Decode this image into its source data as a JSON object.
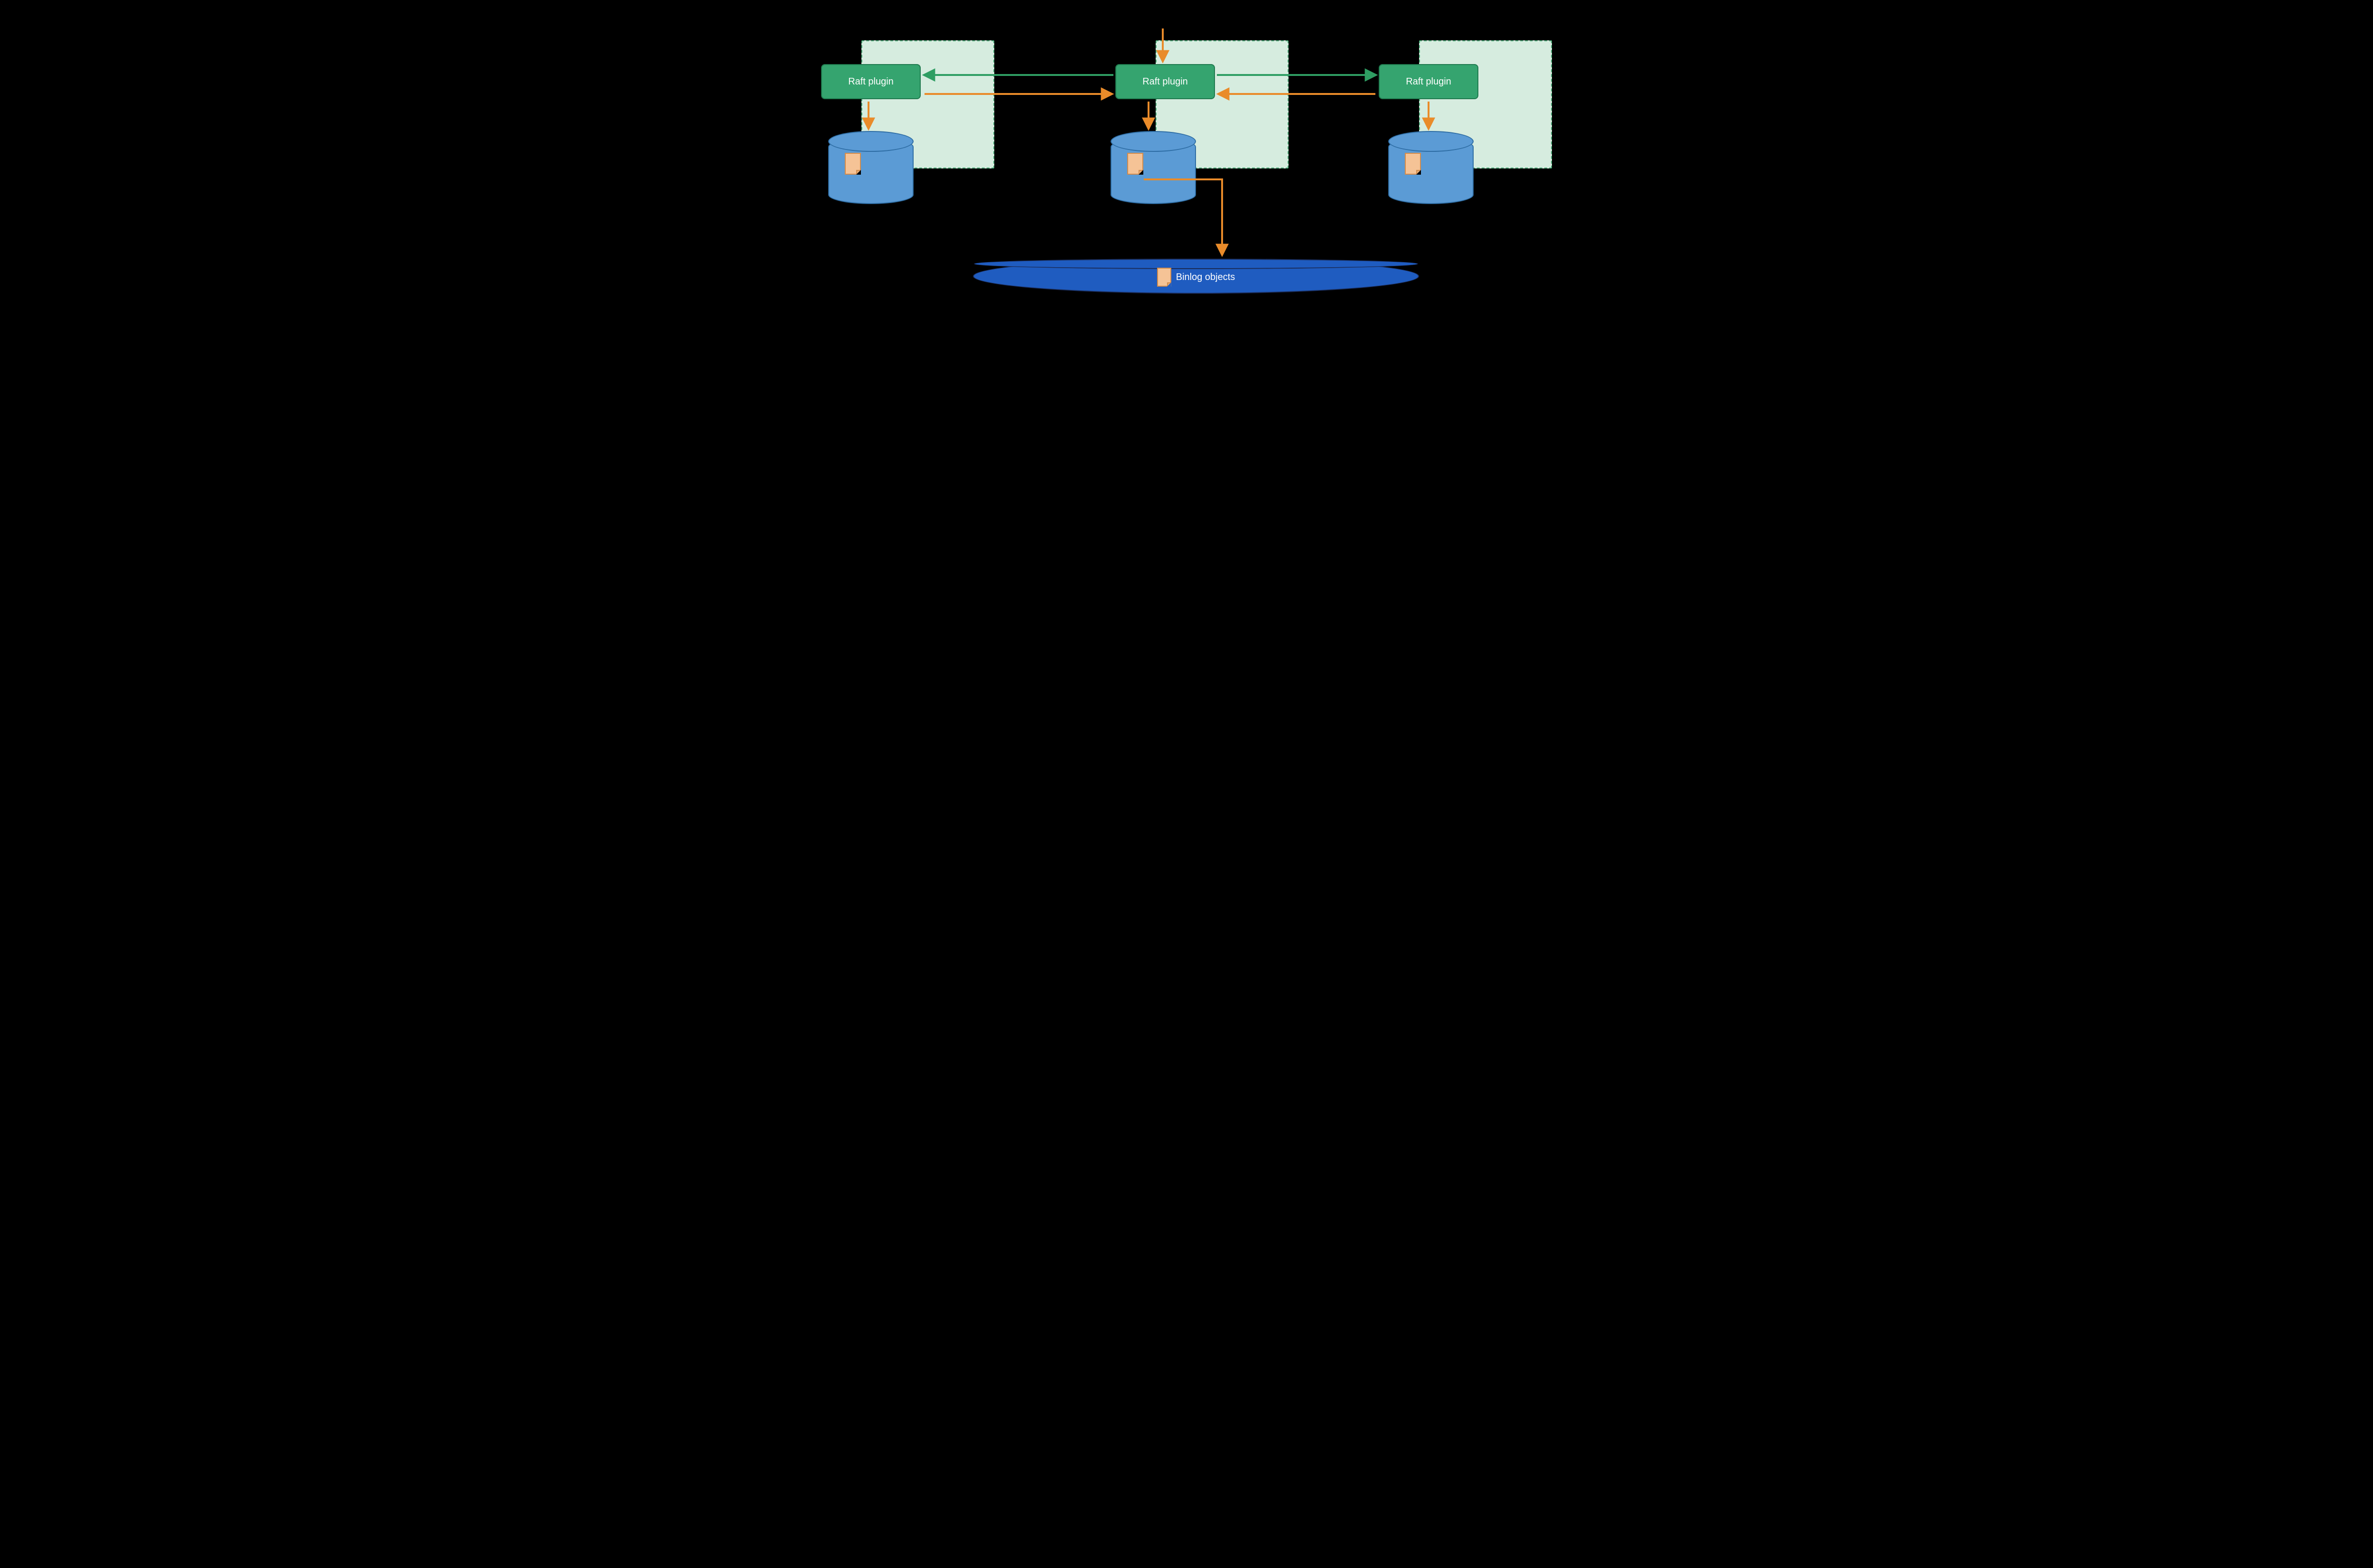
{
  "nodes": {
    "left": {
      "plugin_label": "Raft plugin"
    },
    "center": {
      "plugin_label": "Raft plugin"
    },
    "right": {
      "plugin_label": "Raft plugin"
    }
  },
  "storage": {
    "label": "Binlog objects"
  },
  "colors": {
    "region_fill": "#d6ecdf",
    "region_border": "#53b07f",
    "plugin_fill": "#35a46f",
    "plugin_border": "#1f7a4e",
    "cylinder_fill": "#5b9bd5",
    "cylinder_border": "#2e6da4",
    "note_fill": "#f5c396",
    "note_border": "#d18b4b",
    "store_fill": "#1f5cc0",
    "store_border": "#1a2c5a",
    "arrow_green": "#2f9e63",
    "arrow_orange": "#e98b2a"
  }
}
